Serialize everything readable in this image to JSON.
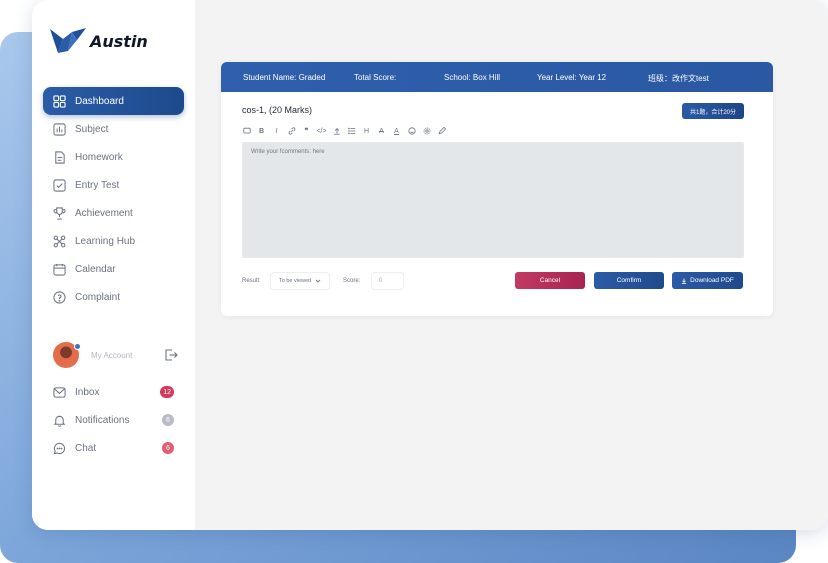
{
  "app": {
    "name": "Austin"
  },
  "sidebar": {
    "items": [
      {
        "label": "Dashboard",
        "icon": "dashboard-icon",
        "active": true
      },
      {
        "label": "Subject",
        "icon": "chart-icon"
      },
      {
        "label": "Homework",
        "icon": "document-icon"
      },
      {
        "label": "Entry Test",
        "icon": "test-icon"
      },
      {
        "label": "Achievement",
        "icon": "trophy-icon"
      },
      {
        "label": "Learning Hub",
        "icon": "hub-icon"
      },
      {
        "label": "Calendar",
        "icon": "calendar-icon"
      },
      {
        "label": "Complaint",
        "icon": "complaint-icon"
      }
    ],
    "account": {
      "label": "My Account"
    },
    "lower": [
      {
        "label": "Inbox",
        "icon": "inbox-icon",
        "badge": "12",
        "badge_color": "#d23b5b"
      },
      {
        "label": "Notifications",
        "icon": "bell-icon",
        "badge": "6",
        "badge_color": "#b9bcc6"
      },
      {
        "label": "Chat",
        "icon": "chat-icon",
        "badge": "6",
        "badge_color": "#e05d72"
      }
    ]
  },
  "card": {
    "header": {
      "student": "Student Name: Graded",
      "total": "Total Score:",
      "school": "School: Box Hill",
      "year": "Year Level: Year 12",
      "class": "班级：改作文test"
    },
    "question_title": "cos-1, (20 Marks)",
    "sum_button": "共1题，合计20分",
    "editor_placeholder": "Write your fcomments: here",
    "result_label": "Result:",
    "result_value": "To be viewed",
    "score_label": "Score:",
    "score_placeholder": "0",
    "buttons": {
      "cancel": "Cancel",
      "confirm": "Comfirm",
      "pdf": "Download PDF"
    }
  },
  "colors": {
    "accent": "#2a58a3",
    "cancel": "#b42c58",
    "badge_red": "#d23b5b"
  }
}
